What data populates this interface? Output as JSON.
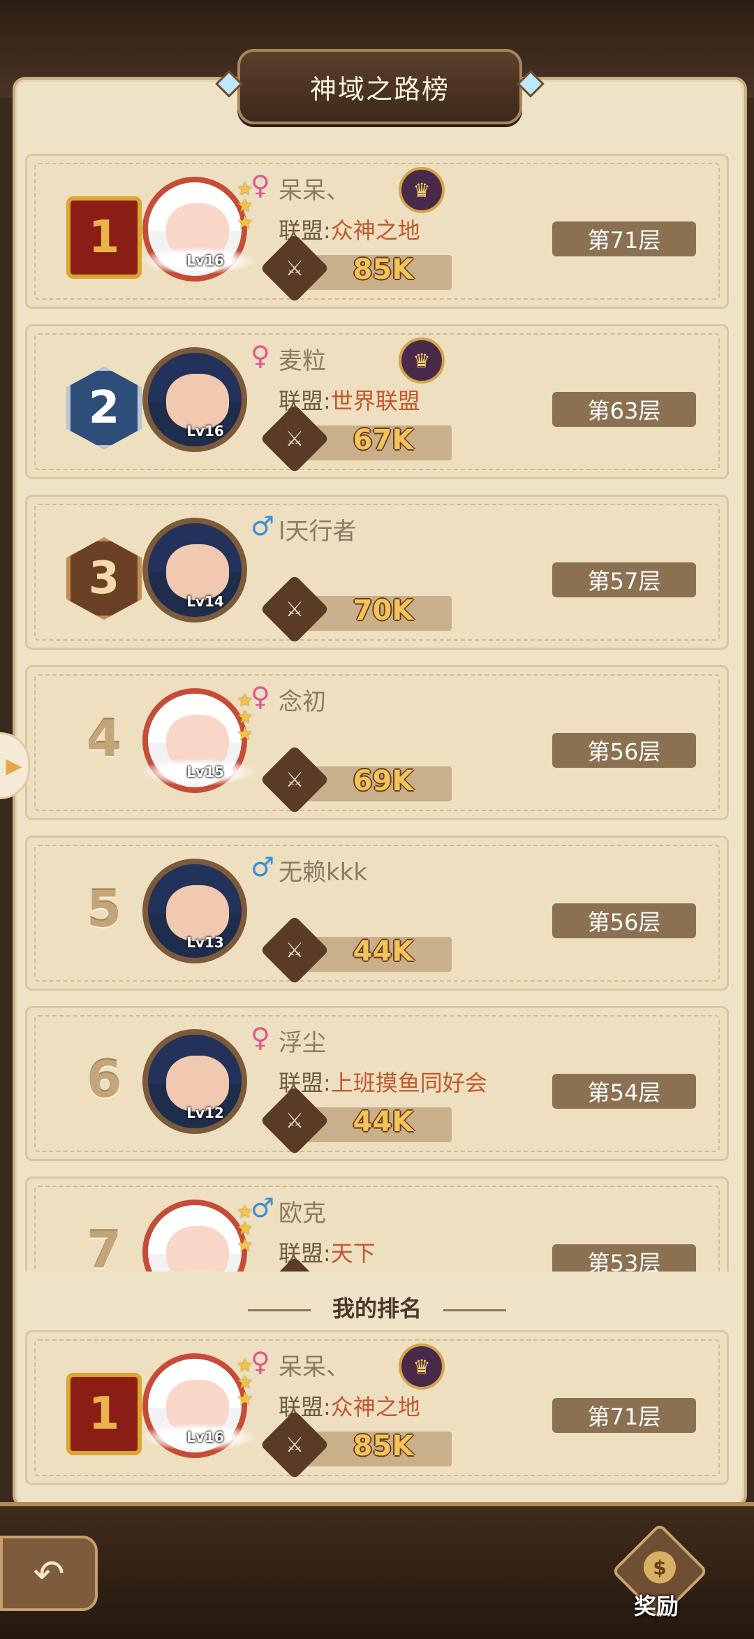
{
  "header": {
    "title": "神域之路榜"
  },
  "rows": [
    {
      "rank": "1",
      "medal": "gold",
      "gender": "♀",
      "gender_type": "female",
      "name": "呆呆、",
      "has_badge": true,
      "alliance_label": "联盟:",
      "alliance_name": "众神之地",
      "power": "85K",
      "floor": "第71层",
      "level": "Lv16",
      "avatar_style": "light"
    },
    {
      "rank": "2",
      "medal": "silver",
      "gender": "♀",
      "gender_type": "female",
      "name": "麦粒",
      "has_badge": true,
      "alliance_label": "联盟:",
      "alliance_name": "世界联盟",
      "power": "67K",
      "floor": "第63层",
      "level": "Lv16",
      "avatar_style": "dark"
    },
    {
      "rank": "3",
      "medal": "bronze",
      "gender": "♂",
      "gender_type": "male",
      "name": "l天行者",
      "has_badge": false,
      "alliance_label": "",
      "alliance_name": "",
      "power": "70K",
      "floor": "第57层",
      "level": "Lv14",
      "avatar_style": "dark"
    },
    {
      "rank": "4",
      "medal": "",
      "gender": "♀",
      "gender_type": "female",
      "name": "念初",
      "has_badge": false,
      "alliance_label": "",
      "alliance_name": "",
      "power": "69K",
      "floor": "第56层",
      "level": "Lv15",
      "avatar_style": "light"
    },
    {
      "rank": "5",
      "medal": "",
      "gender": "♂",
      "gender_type": "male",
      "name": "无赖kkk",
      "has_badge": false,
      "alliance_label": "",
      "alliance_name": "",
      "power": "44K",
      "floor": "第56层",
      "level": "Lv13",
      "avatar_style": "dark"
    },
    {
      "rank": "6",
      "medal": "",
      "gender": "♀",
      "gender_type": "female",
      "name": "浮尘",
      "has_badge": false,
      "alliance_label": "联盟:",
      "alliance_name": "上班摸鱼同好会",
      "power": "44K",
      "floor": "第54层",
      "level": "Lv12",
      "avatar_style": "dark"
    },
    {
      "rank": "7",
      "medal": "",
      "gender": "♂",
      "gender_type": "male",
      "name": "欧克",
      "has_badge": false,
      "alliance_label": "联盟:",
      "alliance_name": "天下",
      "power": "",
      "floor": "第53层",
      "level": "",
      "avatar_style": "light"
    }
  ],
  "my_rank": {
    "section_label": "我的排名",
    "rank": "1",
    "medal": "gold",
    "gender": "♀",
    "gender_type": "female",
    "name": "呆呆、",
    "alliance_label": "联盟:",
    "alliance_name": "众神之地",
    "power": "85K",
    "floor": "第71层",
    "level": "Lv16"
  },
  "bottom": {
    "reward_label": "奖励"
  },
  "colors": {
    "accent": "#c1582e",
    "floor_bg": "#8b7152",
    "power_text": "#f3c45b"
  }
}
